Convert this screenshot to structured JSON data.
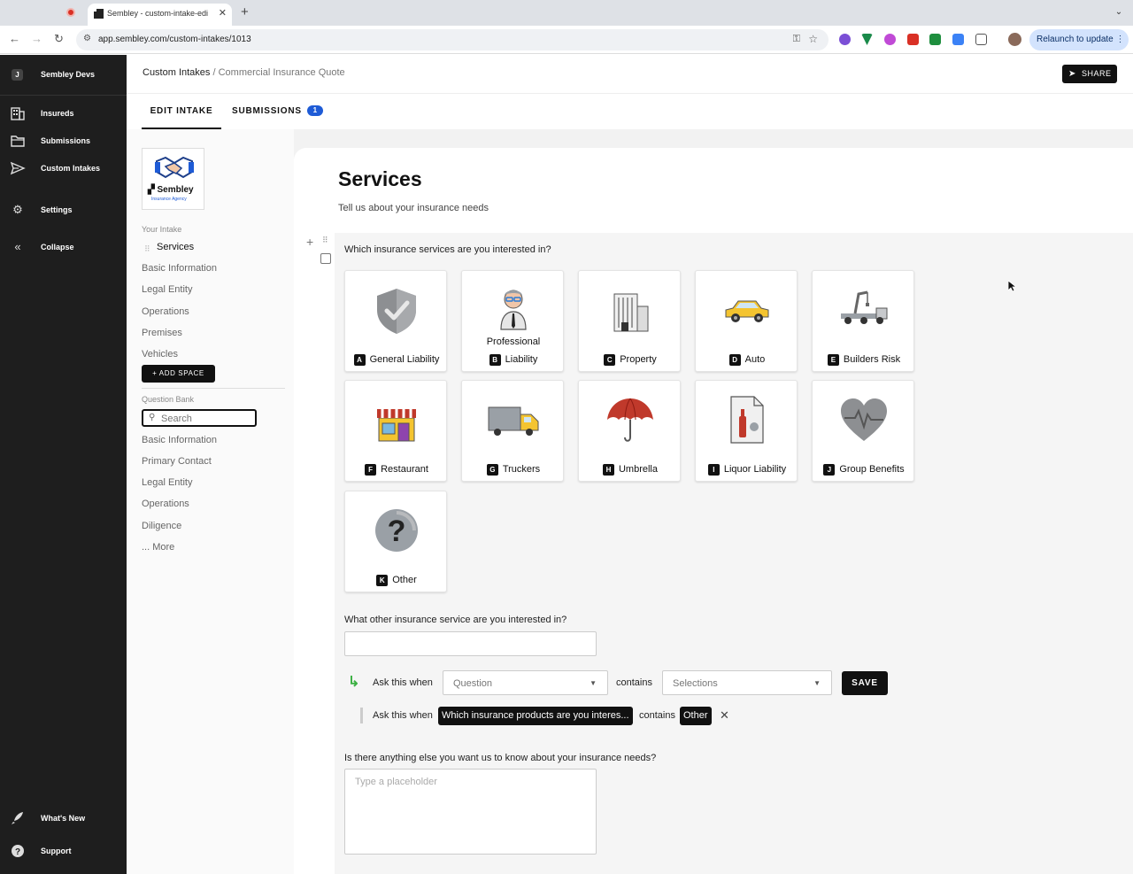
{
  "browser": {
    "tab_title": "Sembley - custom-intake-edi",
    "url": "app.sembley.com/custom-intakes/1013",
    "relaunch_label": "Relaunch to update"
  },
  "sidebar": {
    "brand": "Sembley Devs",
    "brand_initial": "J",
    "items": [
      {
        "label": "Insureds",
        "icon": "building-icon"
      },
      {
        "label": "Submissions",
        "icon": "folder-icon"
      },
      {
        "label": "Custom Intakes",
        "icon": "send-icon"
      },
      {
        "label": "Settings",
        "icon": "gear-icon"
      },
      {
        "label": "Collapse",
        "icon": "double-chevron-left-icon"
      }
    ],
    "bottom": [
      {
        "label": "What's New",
        "icon": "rocket-icon"
      },
      {
        "label": "Support",
        "icon": "help-icon"
      }
    ]
  },
  "header": {
    "breadcrumb_root": "Custom Intakes",
    "breadcrumb_sep": " / ",
    "breadcrumb_current": "Commercial Insurance Quote",
    "share_label": "SHARE",
    "tabs": {
      "edit": "EDIT INTAKE",
      "submissions": "SUBMISSIONS",
      "submissions_count": "1"
    }
  },
  "left_panel": {
    "logo_word": "Sembley",
    "logo_sub": "Insurance Agency",
    "intake_heading": "Your Intake",
    "active_item": "Services",
    "intake_items": [
      "Basic Information",
      "Legal Entity",
      "Operations",
      "Premises",
      "Vehicles"
    ],
    "add_space_label": "+  ADD SPACE",
    "bank_heading": "Question Bank",
    "search_placeholder": "Search",
    "bank_items": [
      "Basic Information",
      "Primary Contact",
      "Legal Entity",
      "Operations",
      "Diligence",
      "... More"
    ]
  },
  "form": {
    "title": "Services",
    "subtitle": "Tell us about your insurance needs",
    "question1": "Which insurance services are you interested in?",
    "options": [
      {
        "key": "A",
        "label": "General Liability",
        "icon": "shield-check-icon"
      },
      {
        "key": "B",
        "label_top": "Professional",
        "label": "Liability",
        "icon": "professional-person-icon"
      },
      {
        "key": "C",
        "label": "Property",
        "icon": "building-icon"
      },
      {
        "key": "D",
        "label": "Auto",
        "icon": "car-icon"
      },
      {
        "key": "E",
        "label": "Builders Risk",
        "icon": "crane-truck-icon"
      },
      {
        "key": "F",
        "label": "Restaurant",
        "icon": "storefront-icon"
      },
      {
        "key": "G",
        "label": "Truckers",
        "icon": "truck-icon"
      },
      {
        "key": "H",
        "label": "Umbrella",
        "icon": "umbrella-icon"
      },
      {
        "key": "I",
        "label": "Liquor Liability",
        "icon": "liquor-document-icon"
      },
      {
        "key": "J",
        "label": "Group Benefits",
        "icon": "heart-pulse-icon"
      },
      {
        "key": "K",
        "label": "Other",
        "icon": "question-mark-icon"
      }
    ],
    "question2": "What other insurance service are you interested in?",
    "condition": {
      "ask_label": "Ask this when",
      "question_placeholder": "Question",
      "contains_label": "contains",
      "selections_placeholder": "Selections",
      "save_label": "SAVE"
    },
    "rule": {
      "ask_label": "Ask this when",
      "question": "Which insurance products are you interes...",
      "contains_label": "contains",
      "value": "Other"
    },
    "question3": "Is there anything else you want us to know about your insurance needs?",
    "textarea_placeholder": "Type a placeholder"
  },
  "colors": {
    "sidebar_bg": "#1e1e1e",
    "accent_blue": "#1e5bd6",
    "condition_arrow": "#3cb043"
  }
}
